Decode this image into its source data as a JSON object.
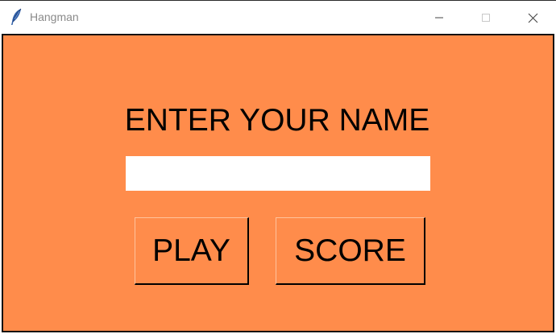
{
  "window": {
    "title": "Hangman",
    "app_icon": "feather-icon",
    "controls": {
      "minimize": "minimize-icon",
      "maximize": "maximize-icon",
      "close": "close-icon"
    }
  },
  "main": {
    "heading": "ENTER YOUR NAME",
    "name_input": {
      "value": "",
      "placeholder": ""
    },
    "buttons": {
      "play_label": "PLAY",
      "score_label": "SCORE"
    }
  },
  "colors": {
    "background": "#ff8c4b",
    "input_background": "#ffffff",
    "text": "#000000",
    "title_text": "#8a8a8a"
  }
}
